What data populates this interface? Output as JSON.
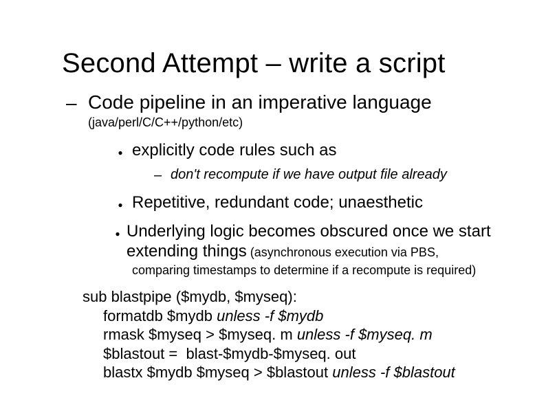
{
  "title": "Second Attempt – write a script",
  "level1": {
    "text": "Code pipeline in an imperative language",
    "note": "(java/perl/C/C++/python/etc)"
  },
  "bullets": {
    "b1": {
      "text": "explicitly code rules such as",
      "sub": "don't recompute if we have output file already"
    },
    "b2": {
      "text": "Repetitive, redundant code; unaesthetic"
    },
    "b3": {
      "text_a": "Underlying logic becomes obscured once we start extending things",
      "note": " (asynchronous execution via PBS,",
      "trailing": "comparing timestamps to determine if a recompute is required)"
    }
  },
  "code": {
    "l1a": "sub blastpipe ($mydb, $myseq):",
    "l2a": "formatdb $mydb ",
    "l2b": "unless -f $mydb",
    "l3a": "rmask $myseq > $myseq. m ",
    "l3b": "unless -f $myseq. m",
    "l4a": "$blastout =  blast-$mydb-$myseq. out",
    "l5a": "blastx $mydb $myseq > $blastout ",
    "l5b": "unless -f $blastout"
  }
}
